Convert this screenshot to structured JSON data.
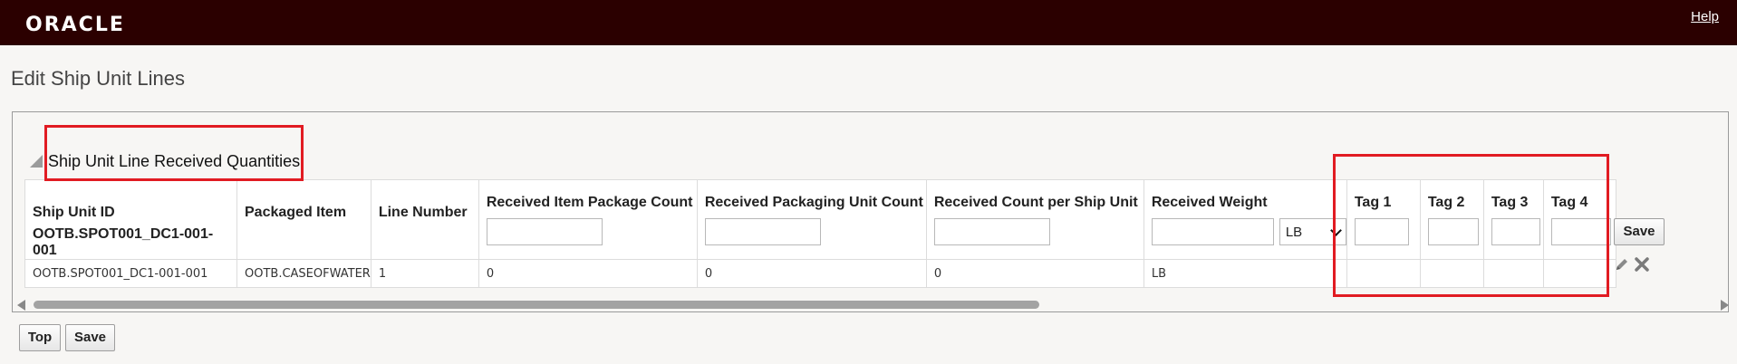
{
  "header": {
    "logo": "ORACLE",
    "help": "Help"
  },
  "page_title": "Edit Ship Unit Lines",
  "section": {
    "title": "Ship Unit Line Received Quantities"
  },
  "table": {
    "columns": {
      "ship_unit_id": "Ship Unit ID",
      "ship_unit_id_value": "OOTB.SPOT001_DC1-001-001",
      "packaged_item": "Packaged Item",
      "line_number": "Line Number",
      "rec_item_pkg_count": "Received Item Package Count",
      "rec_pkg_unit_count": "Received Packaging Unit Count",
      "rec_count_per_su": "Received Count per Ship Unit",
      "rec_weight": "Received Weight",
      "weight_unit": "LB",
      "tag1": "Tag 1",
      "tag2": "Tag 2",
      "tag3": "Tag 3",
      "tag4": "Tag 4"
    },
    "row": {
      "ship_unit_id": "OOTB.SPOT001_DC1-001-001",
      "packaged_item": "OOTB.CASEOFWATER",
      "line_number": "1",
      "rec_item_pkg_count": "0",
      "rec_pkg_unit_count": "0",
      "rec_count_per_su": "0",
      "rec_weight": "LB",
      "tag1": "",
      "tag2": "",
      "tag3": "",
      "tag4": ""
    }
  },
  "buttons": {
    "row_save": "Save",
    "top": "Top",
    "save": "Save"
  },
  "icons": {
    "edit": "pencil-icon",
    "delete": "close-icon"
  },
  "colors": {
    "header_bg": "#2b0000",
    "highlight": "#e11b22"
  }
}
